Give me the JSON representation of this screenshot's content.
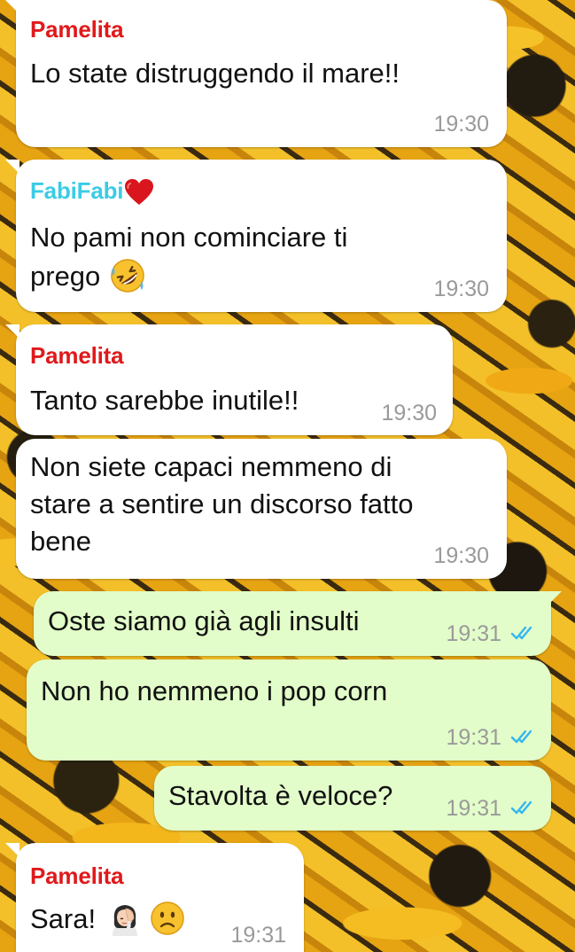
{
  "colors": {
    "incoming_bubble": "#ffffff",
    "outgoing_bubble": "#e2fdc9",
    "sender_pamelita": "#e0191b",
    "sender_fabifabi": "#3ccbe6",
    "time_text": "#9a9a9a",
    "read_ticks": "#34b7f1"
  },
  "messages": [
    {
      "sender": "Pamelita",
      "text": "Lo state distruggendo il mare!!",
      "time": "19:30"
    },
    {
      "sender": "FabiFabi",
      "sender_icon": "red-heart-icon",
      "line1": "No pami non cominciare ti",
      "line2": "prego",
      "emoji": "rolling-on-floor-laughing-emoji",
      "time": "19:30"
    },
    {
      "sender": "Pamelita",
      "text": "Tanto sarebbe inutile!!",
      "time": "19:30"
    },
    {
      "line1": "Non siete capaci nemmeno di",
      "line2": "stare a sentire un discorso fatto",
      "line3": "bene",
      "time": "19:30"
    },
    {
      "text": "Oste siamo già agli insulti",
      "time": "19:31",
      "status_icon": "double-check-read-icon"
    },
    {
      "text": "Non ho nemmeno i pop corn",
      "time": "19:31",
      "status_icon": "double-check-read-icon"
    },
    {
      "text": "Stavolta è veloce?",
      "time": "19:31",
      "status_icon": "double-check-read-icon"
    },
    {
      "sender": "Pamelita",
      "text": "Sara!",
      "emoji1": "woman-facepalming-emoji",
      "emoji2": "slightly-frowning-face-emoji",
      "time": "19:31"
    }
  ]
}
